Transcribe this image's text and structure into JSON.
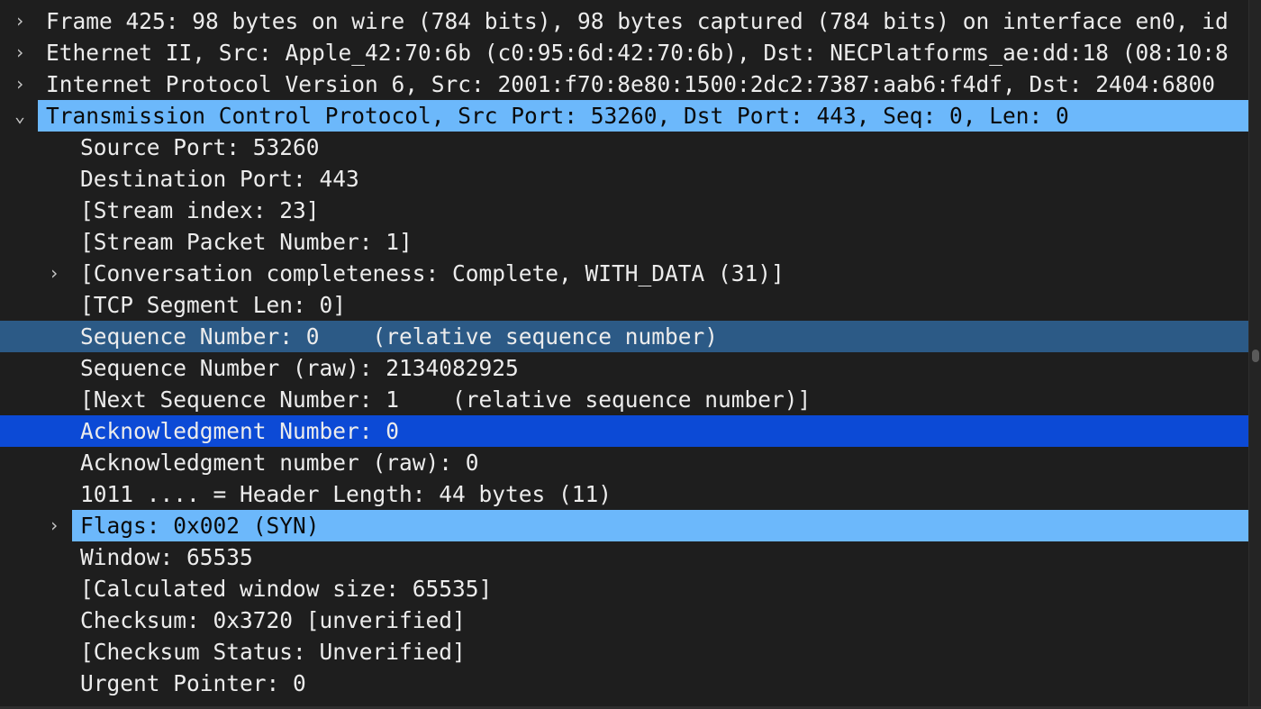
{
  "packet_details": {
    "rows": [
      {
        "text": "Frame 425: 98 bytes on wire (784 bits), 98 bytes captured (784 bits) on interface en0, id",
        "arrow": "›",
        "expanded": false,
        "level": 0,
        "selection": "none"
      },
      {
        "text": "Ethernet II, Src: Apple_42:70:6b (c0:95:6d:42:70:6b), Dst: NECPlatforms_ae:dd:18 (08:10:8",
        "arrow": "›",
        "expanded": false,
        "level": 0,
        "selection": "none"
      },
      {
        "text": "Internet Protocol Version 6, Src: 2001:f70:8e80:1500:2dc2:7387:aab6:f4df, Dst: 2404:6800",
        "arrow": "›",
        "expanded": false,
        "level": 0,
        "selection": "none"
      },
      {
        "text": "Transmission Control Protocol, Src Port: 53260, Dst Port: 443, Seq: 0, Len: 0",
        "arrow": "⌄",
        "expanded": true,
        "level": 0,
        "selection": "light"
      },
      {
        "text": "Source Port: 53260",
        "arrow": "",
        "level": 1,
        "selection": "none"
      },
      {
        "text": "Destination Port: 443",
        "arrow": "",
        "level": 1,
        "selection": "none"
      },
      {
        "text": "[Stream index: 23]",
        "arrow": "",
        "level": 1,
        "selection": "none"
      },
      {
        "text": "[Stream Packet Number: 1]",
        "arrow": "",
        "level": 1,
        "selection": "none"
      },
      {
        "text": "[Conversation completeness: Complete, WITH_DATA (31)]",
        "arrow": "›",
        "expanded": false,
        "level": 1,
        "selection": "none"
      },
      {
        "text": "[TCP Segment Len: 0]",
        "arrow": "",
        "level": 1,
        "selection": "none"
      },
      {
        "text": "Sequence Number: 0    (relative sequence number)",
        "arrow": "",
        "level": 1,
        "selection": "dim"
      },
      {
        "text": "Sequence Number (raw): 2134082925",
        "arrow": "",
        "level": 1,
        "selection": "none"
      },
      {
        "text": "[Next Sequence Number: 1    (relative sequence number)]",
        "arrow": "",
        "level": 1,
        "selection": "none"
      },
      {
        "text": "Acknowledgment Number: 0",
        "arrow": "",
        "level": 1,
        "selection": "active"
      },
      {
        "text": "Acknowledgment number (raw): 0",
        "arrow": "",
        "level": 1,
        "selection": "none"
      },
      {
        "text": "1011 .... = Header Length: 44 bytes (11)",
        "arrow": "",
        "level": 1,
        "selection": "none"
      },
      {
        "text": "Flags: 0x002 (SYN)",
        "arrow": "›",
        "expanded": false,
        "level": 1,
        "selection": "light"
      },
      {
        "text": "Window: 65535",
        "arrow": "",
        "level": 1,
        "selection": "none"
      },
      {
        "text": "[Calculated window size: 65535]",
        "arrow": "",
        "level": 1,
        "selection": "none"
      },
      {
        "text": "Checksum: 0x3720 [unverified]",
        "arrow": "",
        "level": 1,
        "selection": "none"
      },
      {
        "text": "[Checksum Status: Unverified]",
        "arrow": "",
        "level": 1,
        "selection": "none"
      },
      {
        "text": "Urgent Pointer: 0",
        "arrow": "",
        "level": 1,
        "selection": "none"
      }
    ]
  },
  "colors": {
    "background": "#1e1e1e",
    "text": "#ececec",
    "selection_light": "#6cb8fb",
    "selection_dim": "#2c5a86",
    "selection_active": "#0c4ad6"
  }
}
